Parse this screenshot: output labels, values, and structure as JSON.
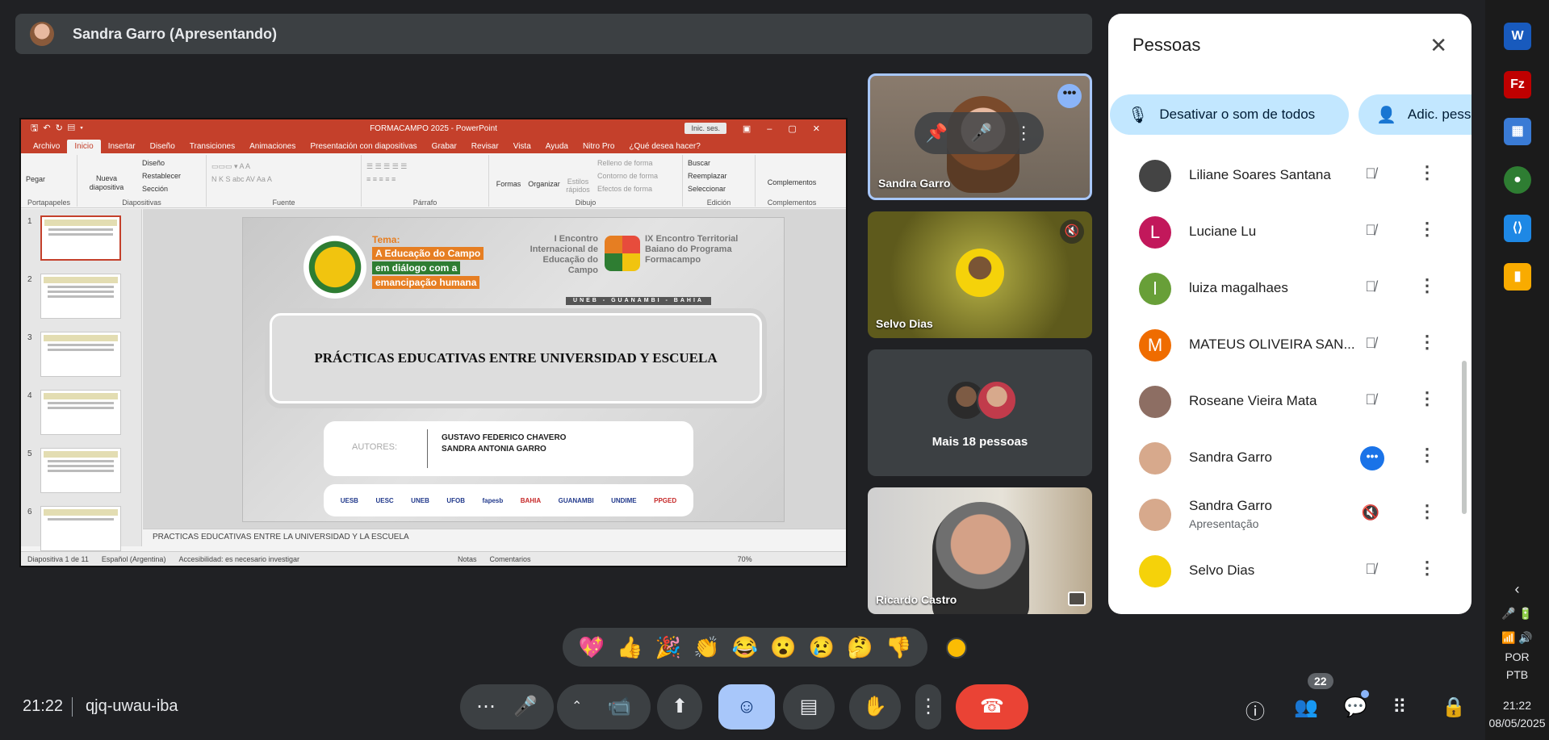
{
  "presenter": {
    "name": "Sandra Garro (Apresentando)"
  },
  "ppt": {
    "title": "FORMACAMPO 2025 - PowerPoint",
    "signin": "Inic. ses.",
    "tabs": [
      "Archivo",
      "Inicio",
      "Insertar",
      "Diseño",
      "Transiciones",
      "Animaciones",
      "Presentación con diapositivas",
      "Grabar",
      "Revisar",
      "Vista",
      "Ayuda",
      "Nitro Pro",
      "¿Qué desea hacer?"
    ],
    "ribbon": {
      "portapapeles": {
        "label": "Portapapeles",
        "pegar": "Pegar"
      },
      "diapositivas": {
        "label": "Diapositivas",
        "nueva": "Nueva diapositiva",
        "diseno": "Diseño",
        "restablecer": "Restablecer",
        "seccion": "Sección"
      },
      "fuente": {
        "label": "Fuente"
      },
      "parrafo": {
        "label": "Párrafo"
      },
      "dibujo": {
        "label": "Dibujo",
        "formas": "Formas",
        "organizar": "Organizar",
        "estilos": "Estilos rápidos",
        "relleno": "Relleno de forma",
        "contorno": "Contorno de forma",
        "efectos": "Efectos de forma"
      },
      "edicion": {
        "label": "Edición",
        "buscar": "Buscar",
        "reemplazar": "Reemplazar",
        "seleccionar": "Seleccionar"
      },
      "complementos": {
        "label": "Complementos",
        "btn": "Complementos"
      }
    },
    "thumb_numbers": [
      "1",
      "2",
      "3",
      "4",
      "5",
      "6"
    ],
    "slide": {
      "tema_label": "Tema:",
      "tema_line1": "A Educação do Campo",
      "tema_line2": "em diálogo com a",
      "tema_line3": "emancipação humana",
      "logo_text": "FORMACAMPO",
      "encontro_left": "I Encontro Internacional de Educação do Campo",
      "encontro_right": "IX Encontro Territorial Baiano do Programa Formacampo",
      "encontro_bar": "UNEB - GUANAMBI - BAHIA",
      "title": "PRÁCTICAS EDUCATIVAS ENTRE UNIVERSIDAD Y ESCUELA",
      "autores_label": "AUTORES:",
      "autor1": "GUSTAVO FEDERICO CHAVERO",
      "autor2": "SANDRA ANTONIA GARRO",
      "logos": [
        "UESB",
        "UESC",
        "UNEB",
        "UFOB",
        "fapesb",
        "BAHIA",
        "GUANAMBI",
        "UNDIME",
        "PPGED"
      ]
    },
    "notes": "PRACTICAS EDUCATIVAS ENTRE LA UNIVERSIDAD Y LA ESCUELA",
    "status": {
      "slide": "Diapositiva 1 de 11",
      "lang": "Español (Argentina)",
      "access": "Accesibilidad: es necesario investigar",
      "notas": "Notas",
      "comentarios": "Comentarios",
      "zoom": "70%"
    }
  },
  "tiles": {
    "t1": "Sandra Garro",
    "t2": "Selvo Dias",
    "t3": "Mais 18 pessoas",
    "t4": "Ricardo Castro"
  },
  "people": {
    "title": "Pessoas",
    "mute_all": "Desativar o som de todos",
    "add": "Adic. pessoas",
    "list": [
      {
        "name": "Liliane Soares Santana",
        "initial": "",
        "color": "#444444"
      },
      {
        "name": "Luciane Lu",
        "initial": "L",
        "color": "#c2185b"
      },
      {
        "name": "luiza magalhaes",
        "initial": "l",
        "color": "#689f38"
      },
      {
        "name": "MATEUS OLIVEIRA SAN...",
        "initial": "M",
        "color": "#ef6c00"
      },
      {
        "name": "Roseane Vieira Mata",
        "initial": "",
        "color": "#8d6e63"
      },
      {
        "name": "Sandra Garro",
        "initial": "",
        "color": "#d7a98c"
      },
      {
        "name": "Sandra Garro",
        "sub": "Apresentação",
        "initial": "",
        "color": "#d7a98c"
      },
      {
        "name": "Selvo Dias",
        "initial": "",
        "color": "#f5d20a"
      }
    ]
  },
  "emoji": [
    "💖",
    "👍",
    "🎉",
    "👏",
    "😂",
    "😮",
    "😢",
    "🤔",
    "👎"
  ],
  "bottom": {
    "time": "21:22",
    "code": "qjq-uwau-iba",
    "participants": "22"
  },
  "taskbar": {
    "lang1": "POR",
    "lang2": "PTB",
    "time": "21:22",
    "date": "08/05/2025"
  },
  "colors": {
    "meet_bg": "#202124",
    "ppt_red": "#c4402b",
    "accent_blue": "#a8c7fa",
    "end_red": "#ea4335"
  }
}
